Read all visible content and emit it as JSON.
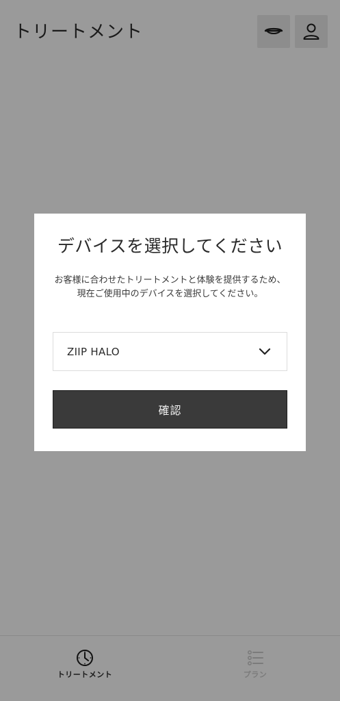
{
  "header": {
    "title": "トリートメント",
    "device_icon": "headset-device-icon",
    "profile_icon": "user-icon"
  },
  "modal": {
    "title": "デバイスを選択してください",
    "description": "お客様に合わせたトリートメントと体験を提供するため、現在ご使用中のデバイスを選択してください。",
    "device_select": {
      "value": "ZIIP HALO",
      "icon": "chevron-down-icon"
    },
    "confirm_label": "確認"
  },
  "bottom_nav": {
    "items": [
      {
        "label": "トリートメント",
        "icon": "clock-icon",
        "active": true
      },
      {
        "label": "プラン",
        "icon": "list-icon",
        "active": false
      }
    ]
  },
  "colors": {
    "backdrop": "#9a9a9a",
    "modal_bg": "#ffffff",
    "button_bg": "#3a3a3a",
    "button_text": "#f2f2f2"
  }
}
